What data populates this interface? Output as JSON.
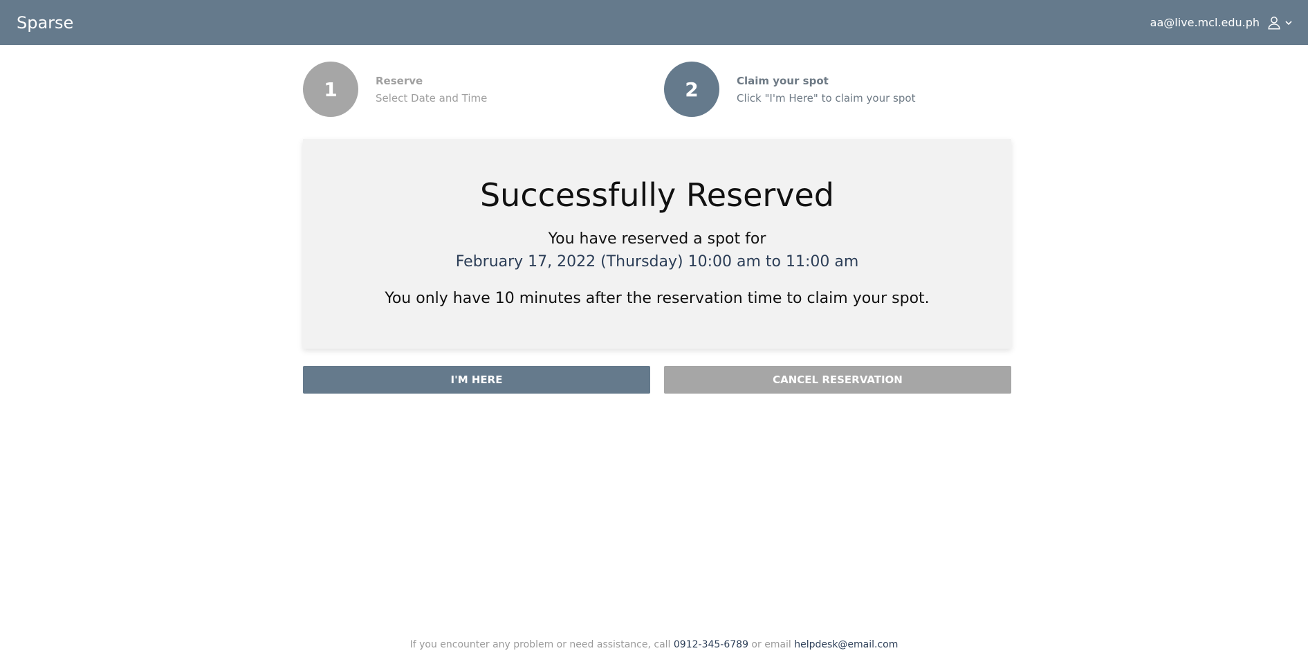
{
  "navbar": {
    "brand": "Sparse",
    "user_email": "aa@live.mcl.edu.ph"
  },
  "steps": [
    {
      "number": "1",
      "title": "Reserve",
      "subtitle": "Select Date and Time"
    },
    {
      "number": "2",
      "title": "Claim your spot",
      "subtitle": "Click \"I'm Here\" to claim your spot"
    }
  ],
  "card": {
    "title": "Successfully Reserved",
    "line1": "You have reserved a spot for",
    "date": "February 17, 2022 (Thursday) 10:00 am to 11:00 am",
    "note": "You only have 10 minutes after the reservation time to claim your spot."
  },
  "buttons": {
    "here": "I'M HERE",
    "cancel": "CANCEL RESERVATION"
  },
  "footer": {
    "prefix": "If you encounter any problem or need assistance, call ",
    "phone": "0912-345-6789",
    "middle": " or email ",
    "email": "helpdesk@email.com"
  },
  "colors": {
    "primary": "#657a8c",
    "inactive": "#a6a6a6",
    "card_bg": "#f2f2f2",
    "date_text": "#2c3e57"
  },
  "icons": [
    "user-icon",
    "chevron-down-icon"
  ]
}
